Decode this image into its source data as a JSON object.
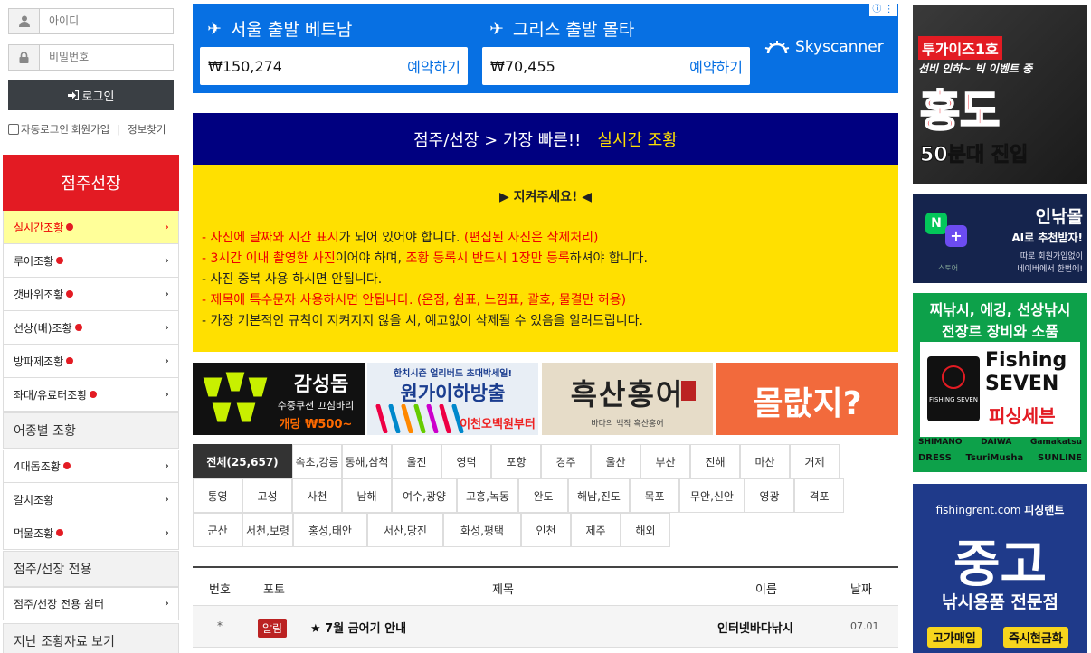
{
  "login": {
    "id_placeholder": "아이디",
    "pw_placeholder": "비밀번호",
    "login_button": "로그인",
    "autologin": "자동로그인",
    "join": "회원가입",
    "find": "정보찾기"
  },
  "sidebar": {
    "header": "점주선장",
    "items1": [
      {
        "label": "실시간조황"
      },
      {
        "label": "루어조황"
      },
      {
        "label": "갯바위조황"
      },
      {
        "label": "선상(배)조황"
      },
      {
        "label": "방파제조황"
      },
      {
        "label": "좌대/유료터조황"
      }
    ],
    "section2": "어종별 조황",
    "items2": [
      {
        "label": "4대돔조황"
      },
      {
        "label": "갈치조황"
      },
      {
        "label": "먹물조황"
      }
    ],
    "section3": "점주/선장 전용",
    "items3": [
      {
        "label": "점주/선장 전용 쉼터"
      }
    ],
    "section4": "지난 조황자료 보기"
  },
  "skyscanner": {
    "route1": "서울 출발 베트남",
    "price1": "₩150,274",
    "route2": "그리스 출발 몰타",
    "price2": "₩70,455",
    "book": "예약하기",
    "brand": "Skyscanner",
    "ad_badge": "ⓘ ⋮"
  },
  "notice": {
    "head_prefix": "점주/선장 > 가장 빠른!!",
    "head_highlight": "실시간 조황",
    "title": "▶ 지켜주세요! ◀",
    "l1a": "- ",
    "l1b": "사진에 날짜와 시간 표시",
    "l1c": "가 되어 있어야 합니다. ",
    "l1d": "(편집된 사진은 삭제처리)",
    "l2a": "- ",
    "l2b": "3시간 이내 촬영한 사진",
    "l2c": "이어야 하며, ",
    "l2d": "조황 등록시 반드시 1장만 등록",
    "l2e": "하셔야 합니다.",
    "l3": "- 사진 중복 사용 하시면 안됩니다.",
    "l4a": "- ",
    "l4b": "제목에 특수문자 사용하시면 안됩니다. (온점, 쉼표, 느낌표, 괄호, 물결만 허용)",
    "l5": "- 가장 기본적인 규칙이 지켜지지 않을 시, 예고없이 삭제될 수 있음을 알려드립니다."
  },
  "banners": {
    "b1_title": "감성돔",
    "b1_sub": "수중쿠션 끄심바리",
    "b1_price": "개당 ₩500~",
    "b2_top": "한치시즌 얼리버드 초대박세일!",
    "b2_title": "원가이하방출",
    "b2_sub": "이천오백원부터",
    "b3_title": "흑산홍어",
    "b3_sub": "바다의 백작 흑산홍어",
    "b4_title": "몰랎지?"
  },
  "tabs": {
    "row1": [
      "전체(25,657)",
      "속초,강릉",
      "동해,삼척",
      "울진",
      "영덕",
      "포항",
      "경주",
      "울산",
      "부산",
      "진해",
      "마산",
      "거제"
    ],
    "row2": [
      "통영",
      "고성",
      "사천",
      "남해",
      "여수,광양",
      "고흥,녹동",
      "완도",
      "해남,진도",
      "목포",
      "무안,신안",
      "영광",
      "격포"
    ],
    "row3": [
      "군산",
      "서천,보령",
      "홍성,태안",
      "서산,당진",
      "화성,평택",
      "인천",
      "제주",
      "해외"
    ]
  },
  "table": {
    "headers": {
      "num": "번호",
      "photo": "포토",
      "title": "제목",
      "name": "이름",
      "date": "날짜"
    },
    "row": {
      "num": "*",
      "badge": "알림",
      "title": "★ 7월 금어기 안내",
      "name": "인터넷바다낚시",
      "date": "07.01"
    }
  },
  "ads": {
    "ad1_top": "투가이즈1호",
    "ad1_mid": "선비 인하~ 빅 이벤트 중",
    "ad1_big": "홍도",
    "ad1_bot": "50분대 진입",
    "ad2_title": "인낚몰",
    "ad2_sub": "AI로 추천받자!",
    "ad2_s1": "따로 회원가입없이",
    "ad2_s2": "네이버에서 한번에!",
    "ad2_store": "스토어",
    "ad3_top1": "찌낚시, 에깅, 선상낚시",
    "ad3_top2": "전장르 장비와 소품",
    "ad3_name1": "Fishing",
    "ad3_name2": "SEVEN",
    "ad3_kr": "피싱세븐",
    "ad3_logo": "FISHING SEVEN",
    "ad3_brands1": [
      "SHIMANO",
      "DAIWA",
      "Gamakatsu"
    ],
    "ad3_brands2": [
      "DRESS",
      "TsuriMusha",
      "SUNLINE"
    ],
    "ad4_url": "fishingrent.com",
    "ad4_brand": "피싱랜트",
    "ad4_big": "중고",
    "ad4_sub": "낚시용품 전문점",
    "ad4_b1": "고가매입",
    "ad4_b2": "즉시현금화"
  },
  "colors": {
    "accent_red": "#e31b23",
    "navy": "#000080",
    "notice_yellow": "#ffe000",
    "sky_blue": "#0770e3"
  }
}
